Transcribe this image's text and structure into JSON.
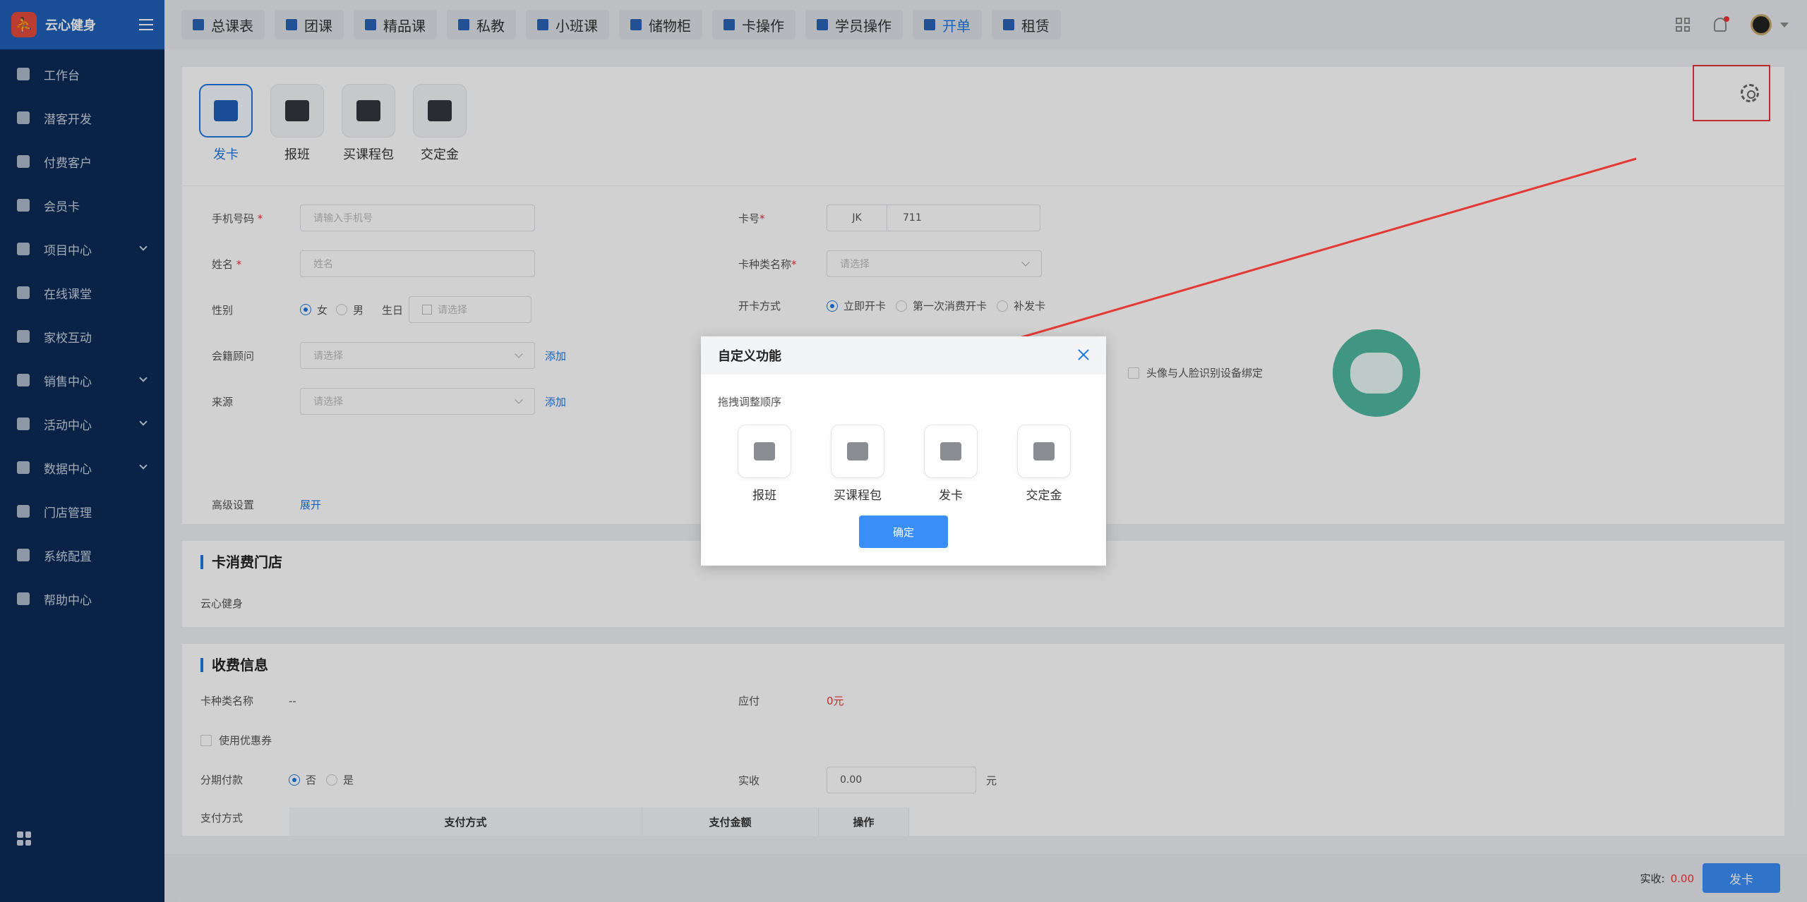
{
  "brand": {
    "name": "云心健身",
    "logo_char": "⛹"
  },
  "sidebar": {
    "items": [
      {
        "label": "工作台",
        "chevron": false
      },
      {
        "label": "潜客开发",
        "chevron": false
      },
      {
        "label": "付费客户",
        "chevron": false
      },
      {
        "label": "会员卡",
        "chevron": false
      },
      {
        "label": "项目中心",
        "chevron": true
      },
      {
        "label": "在线课堂",
        "chevron": false
      },
      {
        "label": "家校互动",
        "chevron": false
      },
      {
        "label": "销售中心",
        "chevron": true
      },
      {
        "label": "活动中心",
        "chevron": true
      },
      {
        "label": "数据中心",
        "chevron": true
      },
      {
        "label": "门店管理",
        "chevron": false
      },
      {
        "label": "系统配置",
        "chevron": false
      },
      {
        "label": "帮助中心",
        "chevron": false
      }
    ]
  },
  "topbar": {
    "tabs": [
      "总课表",
      "团课",
      "精品课",
      "私教",
      "小班课",
      "储物柜",
      "卡操作",
      "学员操作",
      "开单",
      "租赁"
    ],
    "active_tab": "开单"
  },
  "actions": [
    {
      "label": "发卡",
      "active": true
    },
    {
      "label": "报班",
      "active": false
    },
    {
      "label": "买课程包",
      "active": false
    },
    {
      "label": "交定金",
      "active": false
    }
  ],
  "form": {
    "phone": {
      "label": "手机号码",
      "placeholder": "请输入手机号"
    },
    "name": {
      "label": "姓名",
      "placeholder": "姓名"
    },
    "gender": {
      "label": "性别",
      "female": "女",
      "male": "男",
      "birthday_label": "生日",
      "birthday_placeholder": "请选择"
    },
    "advisor": {
      "label": "会籍顾问",
      "placeholder": "请选择",
      "add": "添加"
    },
    "source": {
      "label": "来源",
      "placeholder": "请选择",
      "add": "添加"
    },
    "advanced": {
      "label": "高级设置",
      "expand": "展开"
    },
    "card_no": {
      "label": "卡号",
      "prefix": "JK",
      "value": "711"
    },
    "card_type": {
      "label": "卡种类名称",
      "placeholder": "请选择"
    },
    "open_method": {
      "label": "开卡方式",
      "options": [
        "立即开卡",
        "第一次消费开卡",
        "补发卡"
      ]
    },
    "face_bind": "头像与人脸识别设备绑定"
  },
  "store_section": {
    "title": "卡消费门店",
    "value": "云心健身"
  },
  "payment_section": {
    "title": "收费信息",
    "card_type_label": "卡种类名称",
    "card_type_value": "--",
    "due_label": "应付",
    "due_value": "0元",
    "coupon": "使用优惠券",
    "installment_label": "分期付款",
    "installment_no": "否",
    "installment_yes": "是",
    "paid_label": "实收",
    "paid_value": "0.00",
    "paid_unit": "元",
    "method_label": "支付方式",
    "table_headers": [
      "支付方式",
      "支付金额",
      "操作"
    ]
  },
  "bottombar": {
    "paid_label": "实收:",
    "paid_value": "0.00",
    "issue_button": "发卡"
  },
  "dialog": {
    "title": "自定义功能",
    "hint": "拖拽调整顺序",
    "items": [
      "报班",
      "买课程包",
      "发卡",
      "交定金"
    ],
    "confirm": "确定"
  },
  "colors": {
    "accent": "#1f78e0",
    "sidebar": "#0c2a55",
    "brand_bar": "#1f5fb6",
    "annotation": "#e53935"
  }
}
